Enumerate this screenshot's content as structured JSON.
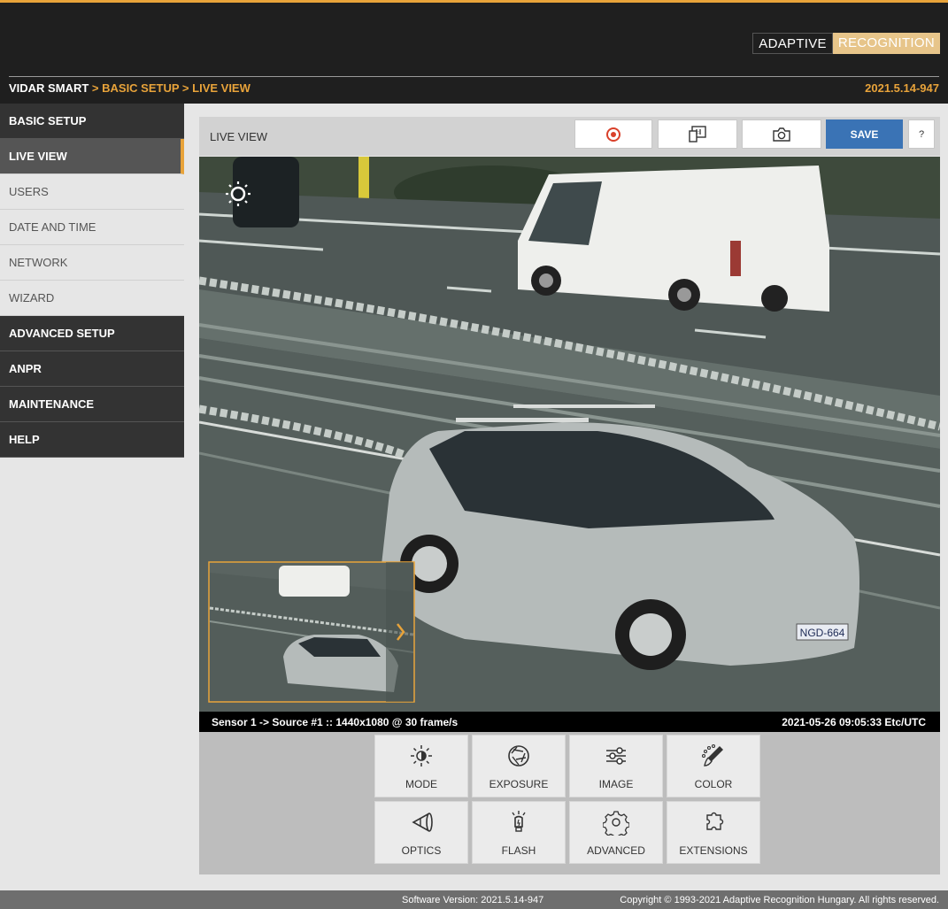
{
  "header": {
    "logo_left": "ADAPTIVE",
    "logo_right": "RECOGNITION",
    "breadcrumb": [
      "VIDAR SMART",
      "BASIC SETUP",
      "LIVE VIEW"
    ],
    "breadcrumb_sep": ">",
    "version": "2021.5.14-947"
  },
  "sidebar": {
    "items": [
      {
        "label": "BASIC SETUP",
        "kind": "section"
      },
      {
        "label": "LIVE VIEW",
        "kind": "active"
      },
      {
        "label": "USERS",
        "kind": "sub"
      },
      {
        "label": "DATE AND TIME",
        "kind": "sub"
      },
      {
        "label": "NETWORK",
        "kind": "sub"
      },
      {
        "label": "WIZARD",
        "kind": "sub"
      },
      {
        "label": "ADVANCED SETUP",
        "kind": "section"
      },
      {
        "label": "ANPR",
        "kind": "section"
      },
      {
        "label": "MAINTENANCE",
        "kind": "section"
      },
      {
        "label": "HELP",
        "kind": "section"
      }
    ]
  },
  "panel": {
    "title": "LIVE VIEW",
    "save_label": "SAVE",
    "help_label": "?",
    "plate_text": "NGD-664",
    "status_left": "Sensor 1 -> Source #1 :: 1440x1080 @ 30 frame/s",
    "status_right": "2021-05-26 09:05:33 Etc/UTC",
    "tiles": [
      {
        "label": "MODE",
        "icon": "brightness-icon"
      },
      {
        "label": "EXPOSURE",
        "icon": "aperture-icon"
      },
      {
        "label": "IMAGE",
        "icon": "sliders-icon"
      },
      {
        "label": "COLOR",
        "icon": "brush-icon"
      },
      {
        "label": "OPTICS",
        "icon": "lens-icon"
      },
      {
        "label": "FLASH",
        "icon": "flash-bulb-icon"
      },
      {
        "label": "ADVANCED",
        "icon": "gear-icon"
      },
      {
        "label": "EXTENSIONS",
        "icon": "puzzle-icon"
      }
    ]
  },
  "footer": {
    "software_version": "Software Version:   2021.5.14-947",
    "copyright": "Copyright © 1993-2021 Adaptive Recognition Hungary. All rights reserved."
  },
  "colors": {
    "accent": "#e8a33a",
    "header_bg": "#1f1f1f",
    "save_blue": "#3a73b5",
    "record_red": "#d9402a"
  }
}
